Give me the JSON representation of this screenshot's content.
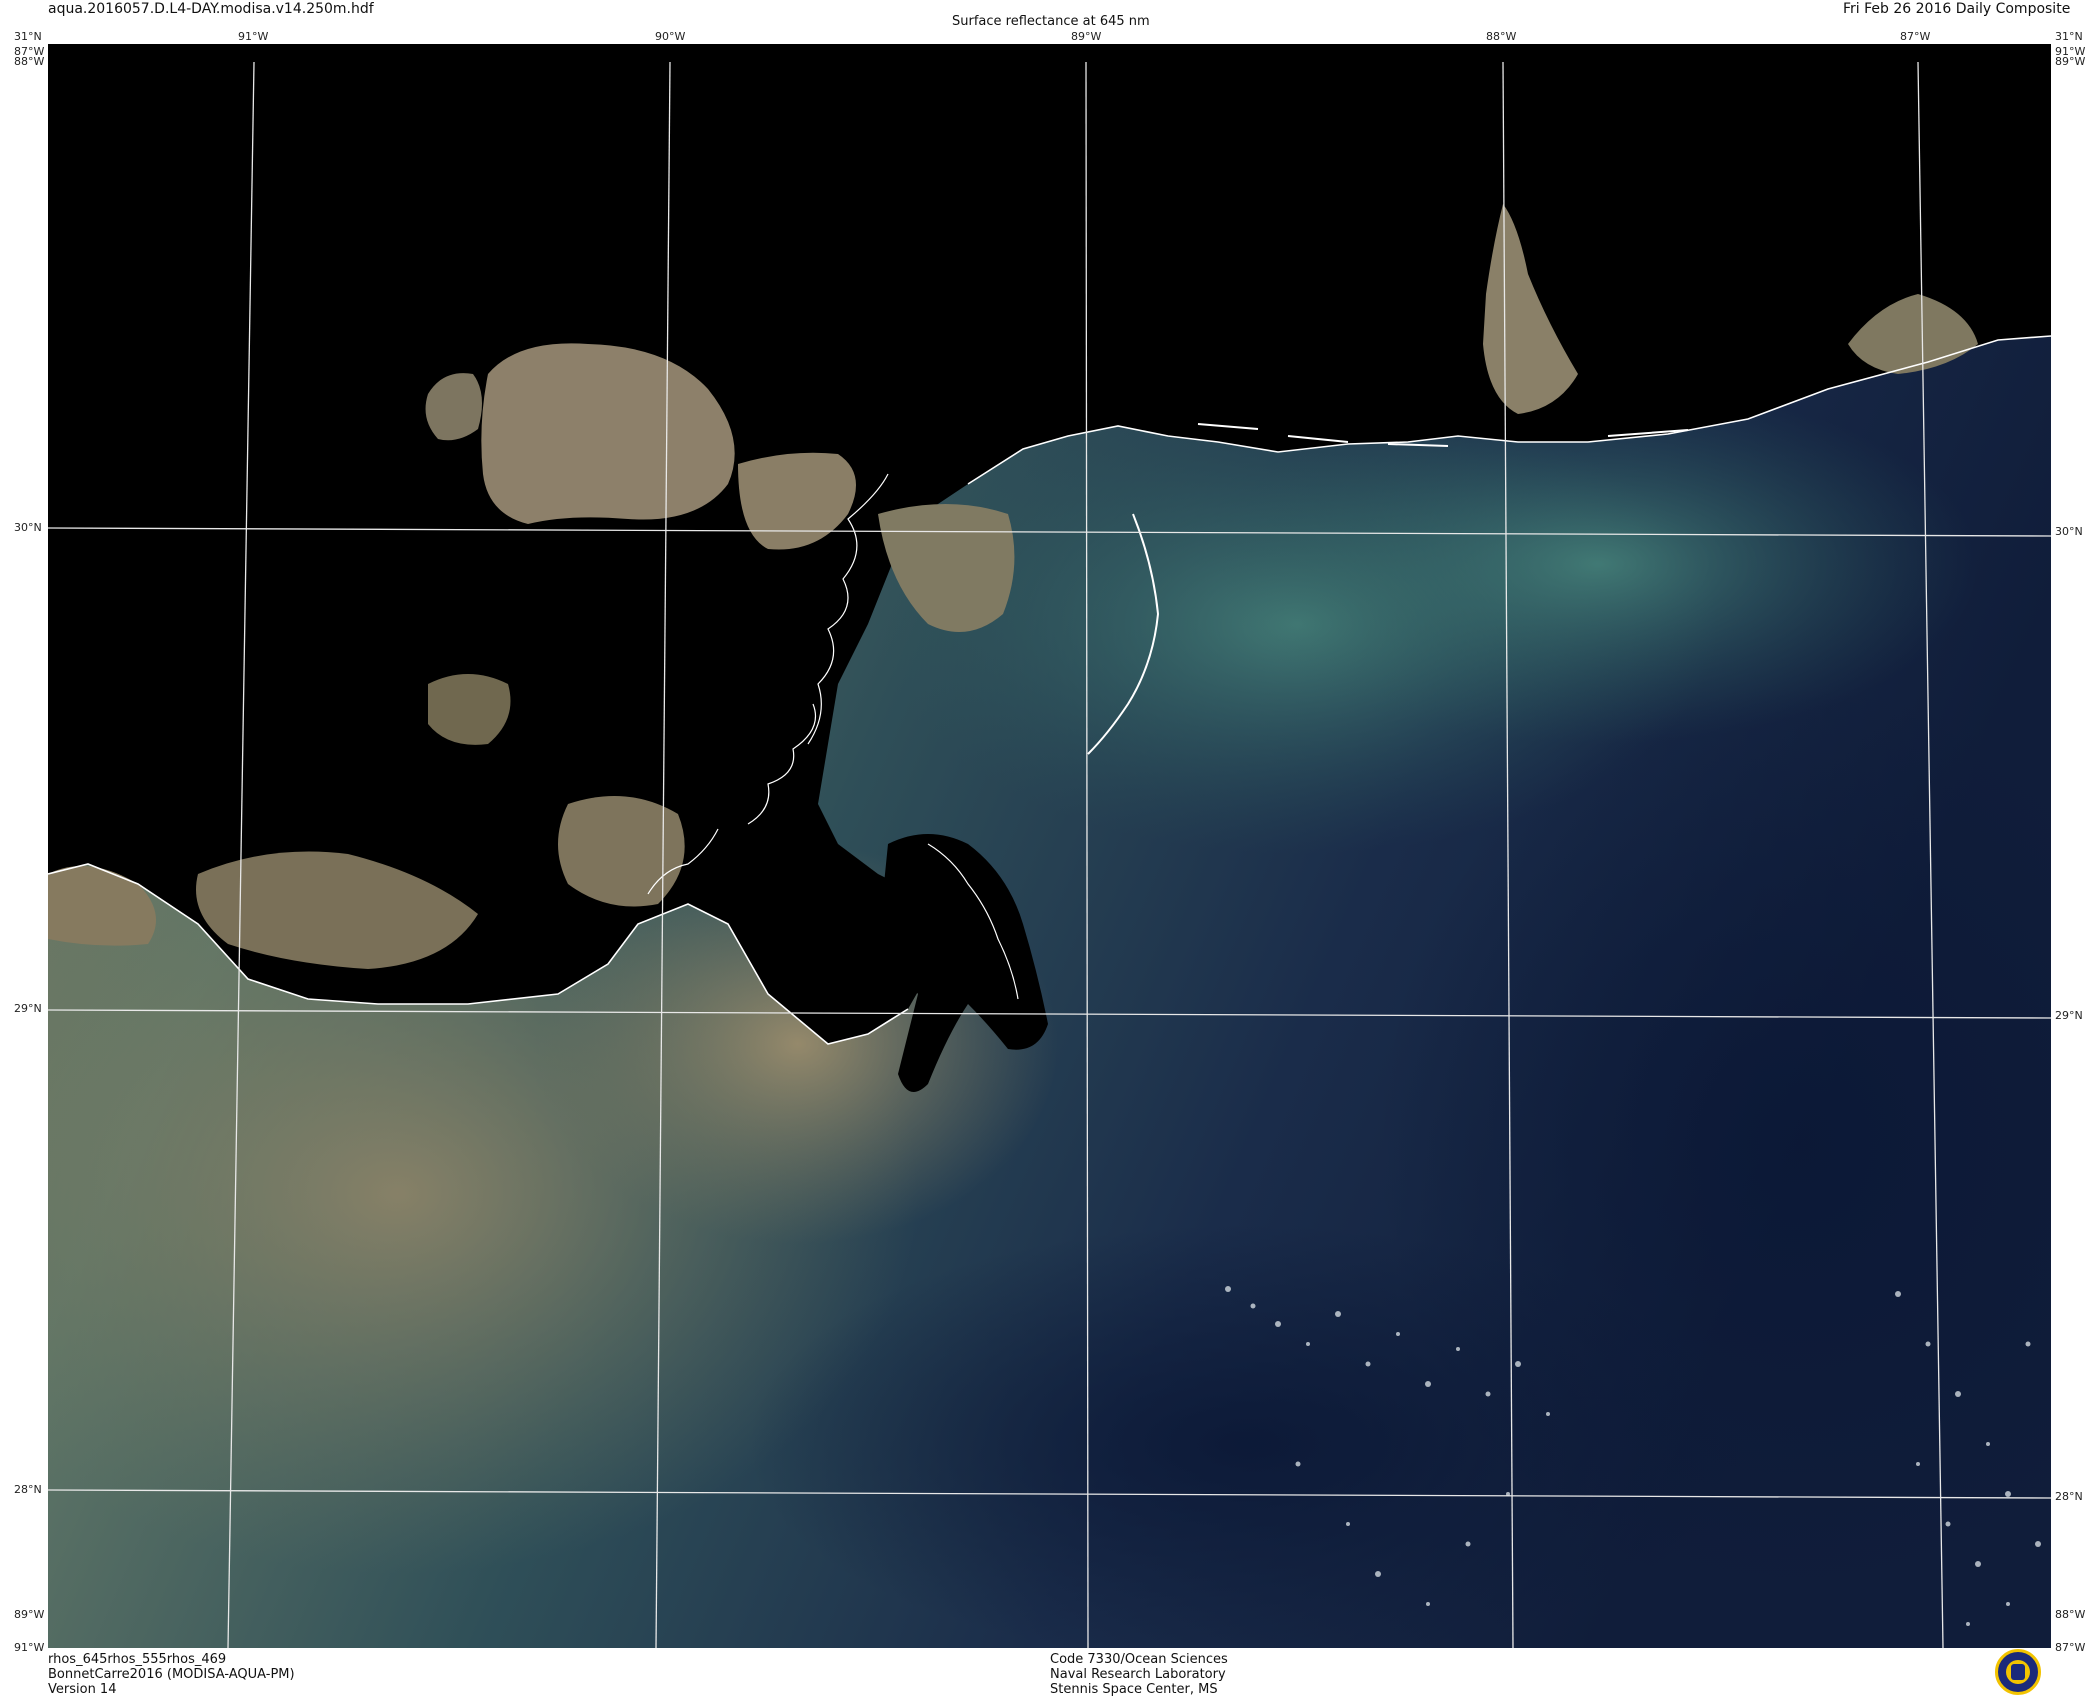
{
  "header": {
    "filename": "aqua.2016057.D.L4-DAY.modisa.v14.250m.hdf",
    "title": "Surface reflectance at 645 nm",
    "date": "Fri Feb 26 2016 Daily Composite"
  },
  "footer": {
    "left": [
      "rhos_645rhos_555rhos_469",
      "BonnetCarre2016 (MODISA-AQUA-PM)",
      "Version 14"
    ],
    "center": [
      "Code 7330/Ocean Sciences",
      "Naval Research Laboratory",
      "Stennis Space Center, MS"
    ]
  },
  "graticule": {
    "top_lon_labels": [
      "91°W",
      "90°W",
      "89°W",
      "88°W",
      "87°W"
    ],
    "lat_labels": [
      "31°N",
      "30°N",
      "29°N",
      "28°N"
    ],
    "corner_labels": {
      "top_left_lat": "31°N",
      "top_left_lon_a": "87°W",
      "top_left_lon_b": "88°W",
      "top_right_lat": "31°N",
      "top_right_lon_a": "91°W",
      "top_right_lon_b": "89°W",
      "bottom_left_lon_a": "89°W",
      "bottom_left_lon_b": "91°W",
      "bottom_right_lon_a": "88°W",
      "bottom_right_lon_b": "87°W"
    },
    "lon_lines_deg": [
      -91,
      -90,
      -89,
      -88,
      -87
    ],
    "lat_lines_deg": [
      31,
      30,
      29,
      28
    ]
  },
  "colors": {
    "land": "#000000",
    "sediment": "#8a7d62",
    "coastal_green": "#4e7468",
    "deep_water": "#101f3c",
    "graticule": "#e8e8e8",
    "coastline": "#ffffff"
  },
  "logo": {
    "name": "nrl-seal-icon"
  }
}
